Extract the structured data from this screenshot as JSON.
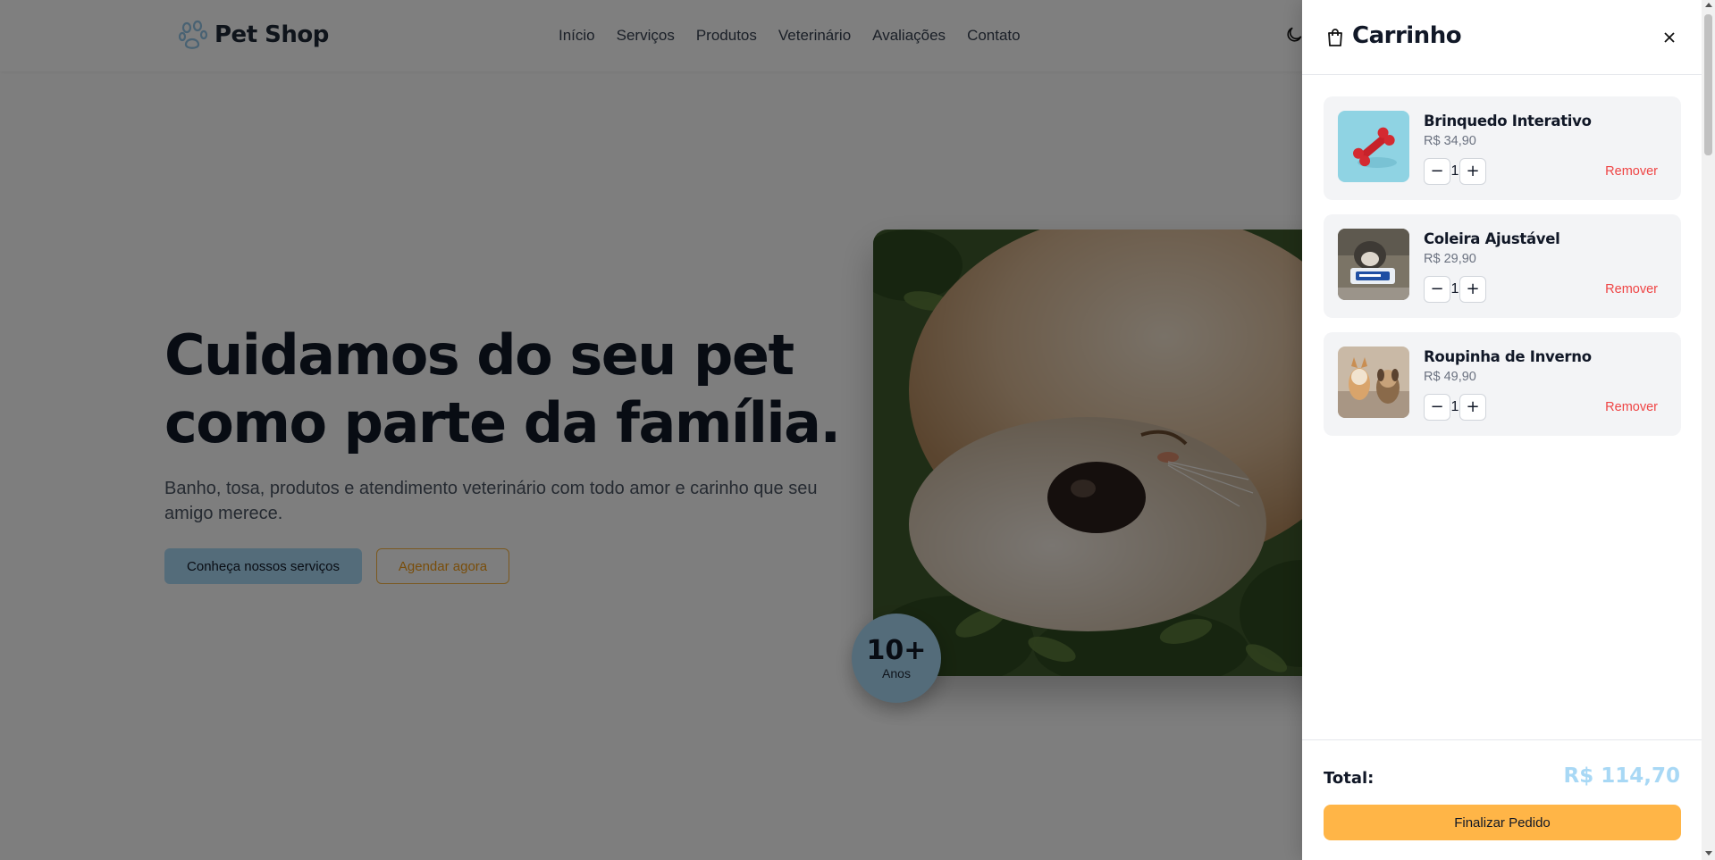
{
  "brand": {
    "name": "Pet Shop"
  },
  "nav": {
    "links": [
      "Início",
      "Serviços",
      "Produtos",
      "Veterinário",
      "Avaliações",
      "Contato"
    ]
  },
  "hero": {
    "title_line1": "Cuidamos do seu pet",
    "title_line2": "como parte da família.",
    "subtitle": "Banho, tosa, produtos e atendimento veterinário com todo amor e carinho que seu amigo merece.",
    "primary_button": "Conheça nossos serviços",
    "secondary_button": "Agendar agora",
    "badge_number": "10+",
    "badge_label": "Anos"
  },
  "cart": {
    "title": "Carrinho",
    "items": [
      {
        "name": "Brinquedo Interativo",
        "price": "R$ 34,90",
        "quantity": "1",
        "remove_label": "Remover",
        "minus": "−",
        "plus": "+"
      },
      {
        "name": "Coleira Ajustável",
        "price": "R$ 29,90",
        "quantity": "1",
        "remove_label": "Remover",
        "minus": "−",
        "plus": "+"
      },
      {
        "name": "Roupinha de Inverno",
        "price": "R$ 49,90",
        "quantity": "1",
        "remove_label": "Remover",
        "minus": "−",
        "plus": "+"
      }
    ],
    "total_label": "Total:",
    "total_value": "R$ 114,70",
    "checkout_button": "Finalizar Pedido"
  },
  "colors": {
    "accent_blue": "#a8d8f5",
    "accent_orange": "#ffb547",
    "remove_red": "#ef4444"
  },
  "icons": [
    "paw-icon",
    "moon-icon",
    "shopping-bag-icon",
    "close-icon",
    "minus-icon",
    "plus-icon"
  ]
}
